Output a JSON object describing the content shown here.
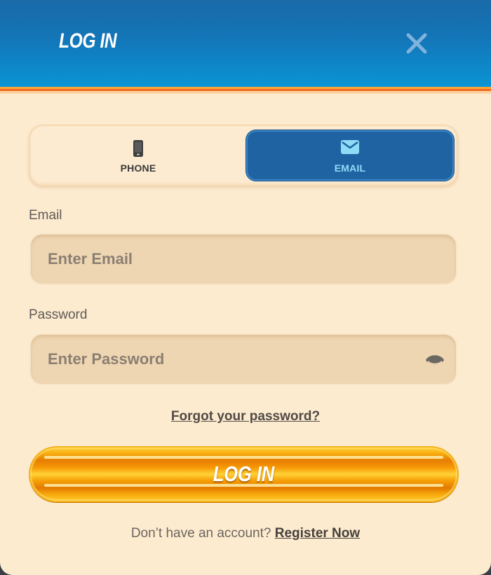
{
  "header": {
    "title": "LOG IN",
    "close_icon": "close-icon"
  },
  "tabs": [
    {
      "label": "PHONE",
      "icon": "phone-icon",
      "active": false
    },
    {
      "label": "EMAIL",
      "icon": "envelope-icon",
      "active": true
    }
  ],
  "form": {
    "email": {
      "label": "Email",
      "placeholder": "Enter Email",
      "value": ""
    },
    "password": {
      "label": "Password",
      "placeholder": "Enter Password",
      "value": "",
      "toggle_icon": "eye-icon"
    },
    "forgot_label": "Forgot your password?",
    "submit_label": "LOG IN"
  },
  "footer": {
    "prompt": "Don’t have an account?",
    "register_label": "Register Now"
  },
  "colors": {
    "header_blue": "#1376b8",
    "panel_bg": "#fdebd0",
    "tab_active": "#1f63a3",
    "button_orange": "#f7a90c",
    "accent_stripe": "#f36a1e"
  }
}
